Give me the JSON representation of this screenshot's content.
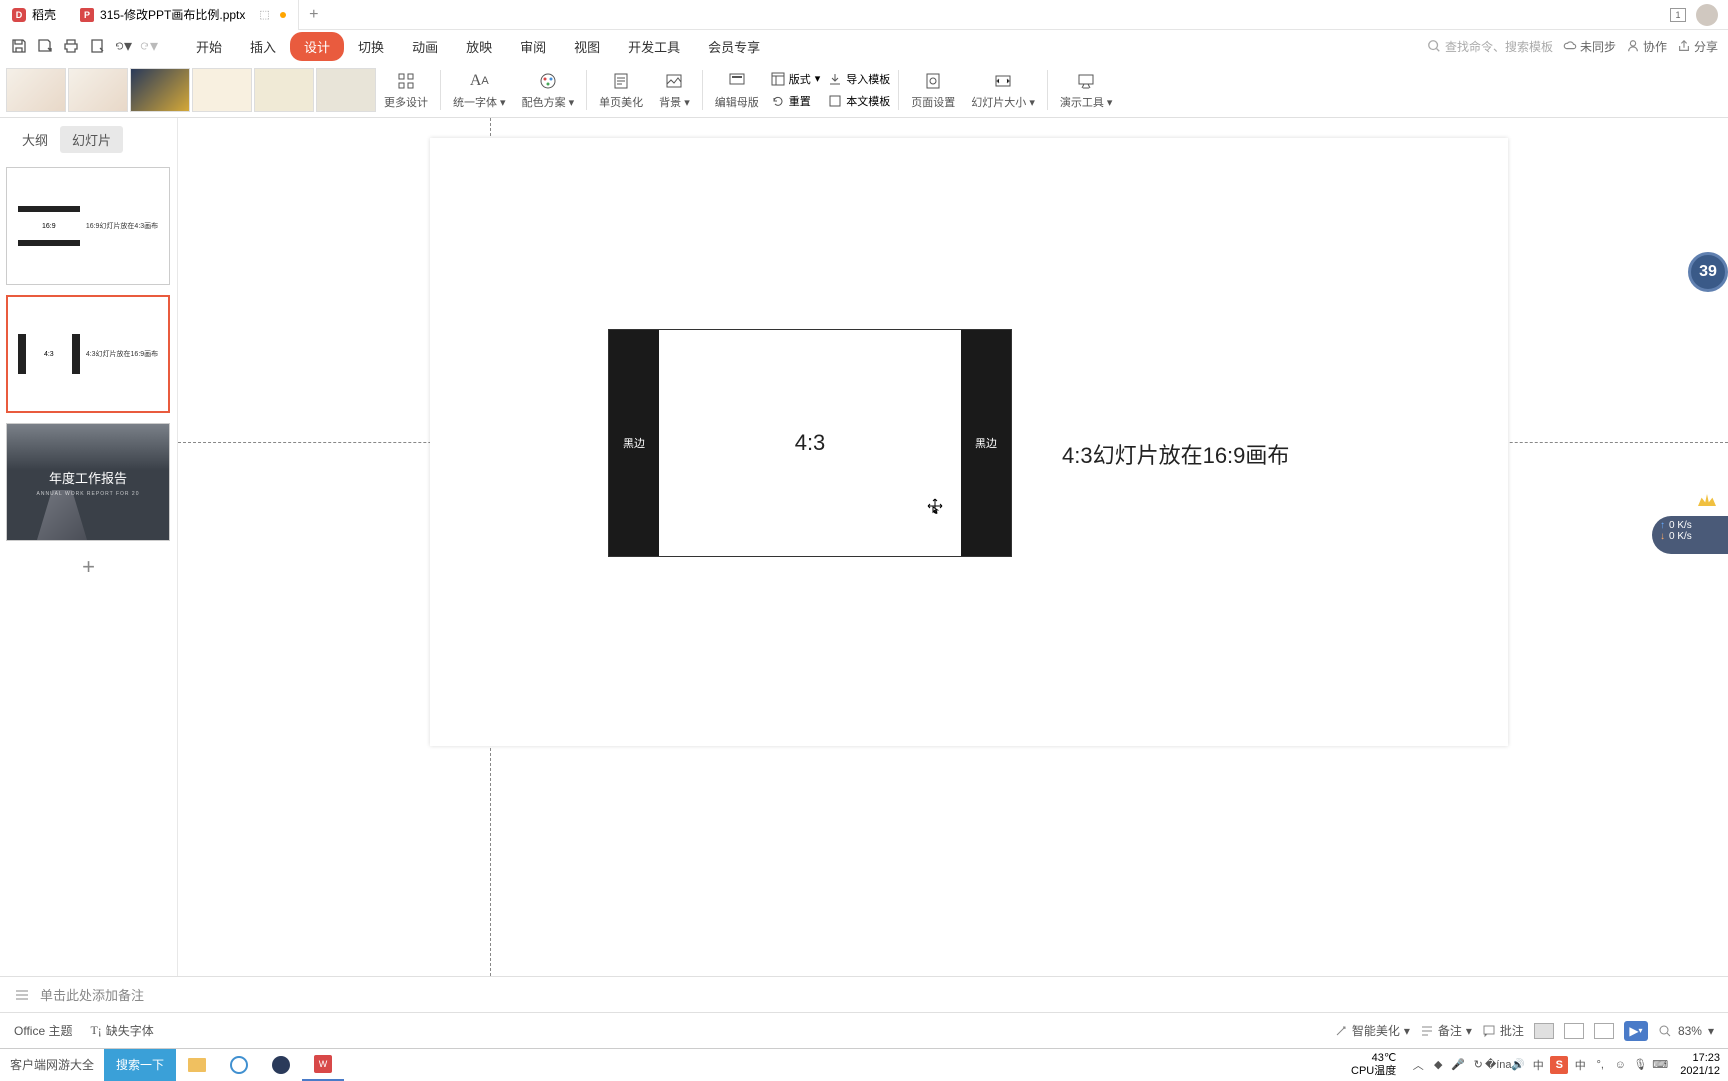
{
  "titlebar": {
    "home_tab": "稻壳",
    "doc_tab": "315-修改PPT画布比例.pptx",
    "window_num": "1"
  },
  "menubar": {
    "tabs": [
      "开始",
      "插入",
      "设计",
      "切换",
      "动画",
      "放映",
      "审阅",
      "视图",
      "开发工具",
      "会员专享"
    ],
    "active_index": 2,
    "search_placeholder": "查找命令、搜索模板",
    "unsync": "未同步",
    "collab": "协作",
    "share": "分享"
  },
  "ribbon": {
    "more_design": "更多设计",
    "unify_font": "统一字体",
    "color_scheme": "配色方案",
    "page_beauty": "单页美化",
    "background": "背景",
    "edit_master": "编辑母版",
    "layout": "版式",
    "import_template": "导入模板",
    "reset": "重置",
    "body_template": "本文模板",
    "page_setup": "页面设置",
    "slide_size": "幻灯片大小",
    "present_tools": "演示工具"
  },
  "side": {
    "outline": "大纲",
    "slides": "幻灯片",
    "thumb1_box": "16:9",
    "thumb1_text": "16:9幻灯片放在4:3画布",
    "thumb2_box": "4:3",
    "thumb2_text": "4:3幻灯片放在16:9画布",
    "thumb3_title": "年度工作报告",
    "thumb3_sub": "ANNUAL WORK REPORT FOR 20"
  },
  "canvas": {
    "black_left": "黑边",
    "black_right": "黑边",
    "center": "4:3",
    "side_text": "4:3幻灯片放在16:9画布"
  },
  "notes": {
    "placeholder": "单击此处添加备注"
  },
  "status": {
    "office_theme": "Office 主题",
    "missing_font": "缺失字体",
    "smart_beauty": "智能美化",
    "notes_btn": "备注",
    "comment_btn": "批注",
    "zoom": "83%"
  },
  "taskbar": {
    "label": "客户端网游大全",
    "search": "搜索一下",
    "temp": "43℃",
    "temp_label": "CPU温度",
    "ime": "中",
    "time": "17:23",
    "date": "2021/12"
  },
  "float": {
    "timer": "39",
    "net_up": "0 K/s",
    "net_down": "0 K/s"
  }
}
